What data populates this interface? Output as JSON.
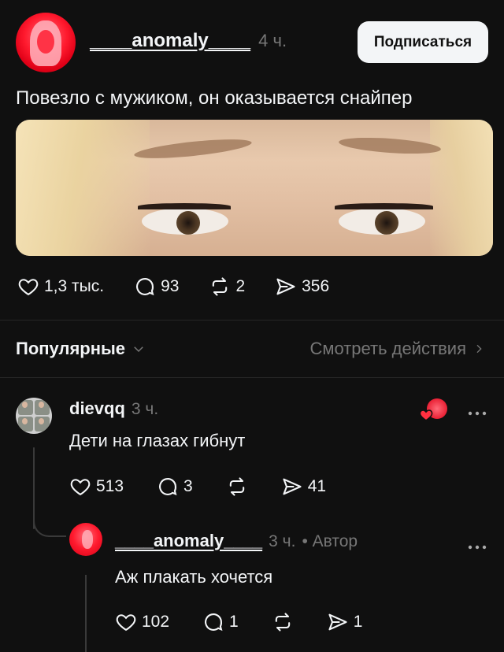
{
  "post": {
    "username": "____anomaly____",
    "time": "4 ч.",
    "follow_label": "Подписаться",
    "text": "Повезло с мужиком, он оказывается снайпер",
    "stats": {
      "likes": "1,3 тыс.",
      "comments": "93",
      "reposts": "2",
      "shares": "356"
    }
  },
  "filter": {
    "sort_label": "Популярные",
    "view_activity_label": "Смотреть действия"
  },
  "comments": [
    {
      "username": "dievqq",
      "time": "3 ч.",
      "text": "Дети на глазах гибнут",
      "likes": "513",
      "replies": "3",
      "shares": "41"
    },
    {
      "username": "____anomaly____",
      "time": "3 ч.",
      "author_label": "• Автор",
      "text": "Аж плакать хочется",
      "likes": "102",
      "replies": "1",
      "shares": "1"
    }
  ],
  "colors": {
    "background": "#101010",
    "text": "#f3f5f7",
    "muted": "#777777",
    "avatar_red": "#ff1a2e"
  },
  "icons": [
    "heart-icon",
    "comment-icon",
    "repost-icon",
    "share-icon",
    "chevron-down-icon",
    "chevron-right-icon",
    "more-icon"
  ]
}
